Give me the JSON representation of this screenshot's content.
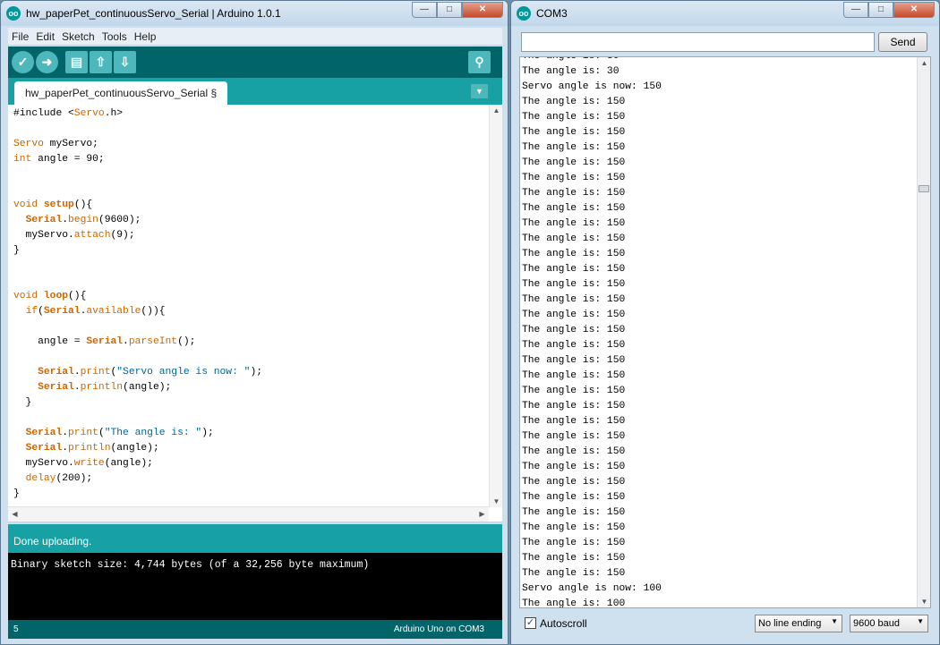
{
  "ide": {
    "title": "hw_paperPet_continuousServo_Serial | Arduino 1.0.1",
    "logo": "oo",
    "menu": [
      "File",
      "Edit",
      "Sketch",
      "Tools",
      "Help"
    ],
    "toolbar_icons": [
      "verify-icon",
      "upload-icon",
      "new-icon",
      "open-icon",
      "save-icon",
      "serial-monitor-icon"
    ],
    "tab_label": "hw_paperPet_continuousServo_Serial §",
    "status": "Done uploading.",
    "console": "Binary sketch size: 4,744 bytes (of a 32,256 byte maximum)",
    "line_number": "5",
    "board": "Arduino Uno on COM3",
    "accent": "#00979c"
  },
  "serial": {
    "title": "COM3",
    "send_label": "Send",
    "input_value": "",
    "output": [
      "The angle is: 30",
      "The angle is: 30",
      "Servo angle is now: 150",
      "The angle is: 150",
      "The angle is: 150",
      "The angle is: 150",
      "The angle is: 150",
      "The angle is: 150",
      "The angle is: 150",
      "The angle is: 150",
      "The angle is: 150",
      "The angle is: 150",
      "The angle is: 150",
      "The angle is: 150",
      "The angle is: 150",
      "The angle is: 150",
      "The angle is: 150",
      "The angle is: 150",
      "The angle is: 150",
      "The angle is: 150",
      "The angle is: 150",
      "The angle is: 150",
      "The angle is: 150",
      "The angle is: 150",
      "The angle is: 150",
      "The angle is: 150",
      "The angle is: 150",
      "The angle is: 150",
      "The angle is: 150",
      "The angle is: 150",
      "The angle is: 150",
      "The angle is: 150",
      "The angle is: 150",
      "The angle is: 150",
      "The angle is: 150",
      "Servo angle is now: 100",
      "The angle is: 100",
      "The angle is: 100"
    ],
    "autoscroll_label": "Autoscroll",
    "autoscroll_checked": true,
    "line_ending": "No line ending",
    "baud": "9600 baud"
  }
}
